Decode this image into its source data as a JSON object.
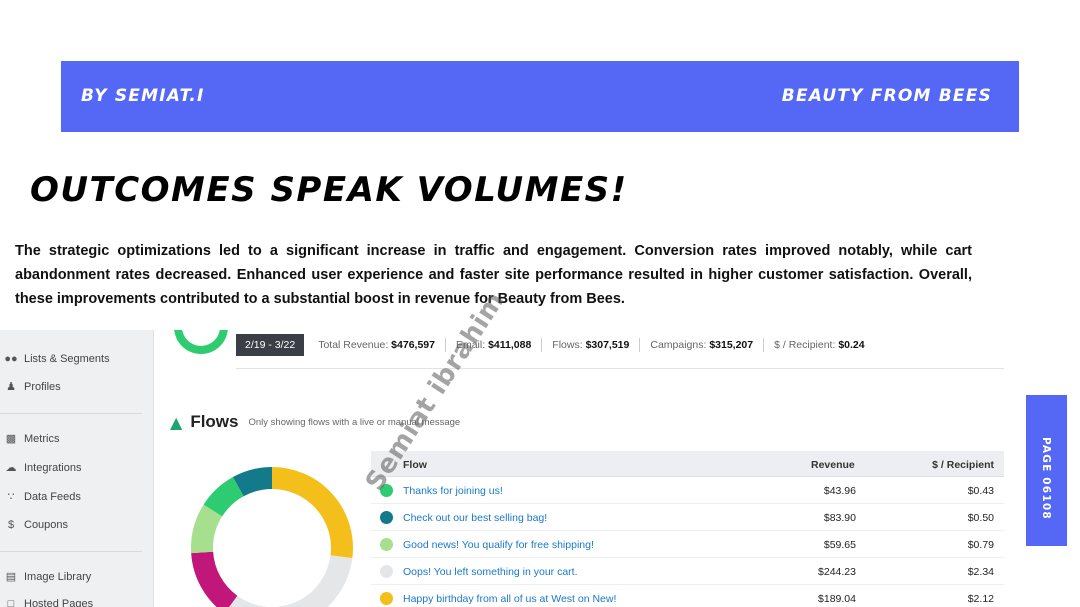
{
  "banner": {
    "left_text": "BY SEMIAT.I",
    "right_text": "BEAUTY FROM BEES",
    "color": "#5468f5"
  },
  "headline": "OUTCOMES SPEAK VOLUMES!",
  "body": "The strategic optimizations led to a significant increase in traffic and engagement. Conversion rates improved notably, while cart abandonment rates decreased. Enhanced user experience and faster site performance resulted in higher customer satisfaction. Overall, these improvements contributed to a substantial boost in revenue for Beauty from Bees.",
  "sidebar": {
    "items": [
      {
        "label": "Lists & Segments",
        "icon": "users-icon"
      },
      {
        "label": "Profiles",
        "icon": "person-icon"
      },
      {
        "label": "Metrics",
        "icon": "bar-chart-icon"
      },
      {
        "label": "Integrations",
        "icon": "cloud-icon"
      },
      {
        "label": "Data Feeds",
        "icon": "rss-icon"
      },
      {
        "label": "Coupons",
        "icon": "dollar-icon"
      },
      {
        "label": "Image Library",
        "icon": "image-icon"
      },
      {
        "label": "Hosted Pages",
        "icon": "page-icon"
      }
    ]
  },
  "stats": {
    "date_range": "2/19 - 3/22",
    "total_revenue_label": "Total Revenue:",
    "total_revenue": "$476,597",
    "email_label": "Email:",
    "email": "$411,088",
    "flows_label": "Flows:",
    "flows": "$307,519",
    "campaigns_label": "Campaigns:",
    "campaigns": "$315,207",
    "per_recipient_label": "$ / Recipient:",
    "per_recipient": "$0.24"
  },
  "flows_section": {
    "title": "Flows",
    "subtitle": "Only showing flows with a live or manual message",
    "headers": {
      "flow": "Flow",
      "revenue": "Revenue",
      "per_recipient": "$ / Recipient"
    },
    "rows": [
      {
        "name": "Thanks for joining us!",
        "revenue": "$43.96",
        "per_recipient": "$0.43",
        "color": "#2ecc71"
      },
      {
        "name": "Check out our best selling bag!",
        "revenue": "$83.90",
        "per_recipient": "$0.50",
        "color": "#137a8c"
      },
      {
        "name": "Good news! You qualify for free shipping!",
        "revenue": "$59.65",
        "per_recipient": "$0.79",
        "color": "#a6e08f"
      },
      {
        "name": "Oops! You left something in your cart.",
        "revenue": "$244.23",
        "per_recipient": "$2.34",
        "color": "#e4e6e8"
      },
      {
        "name": "Happy birthday from all of us at West on New!",
        "revenue": "$189.04",
        "per_recipient": "$2.12",
        "color": "#f4bf1a"
      }
    ],
    "donut_segments": [
      {
        "color": "#f4bf1a",
        "share": 0.27
      },
      {
        "color": "#e4e6e8",
        "share": 0.33
      },
      {
        "color": "#c2177a",
        "share": 0.14
      },
      {
        "color": "#a6e08f",
        "share": 0.1
      },
      {
        "color": "#2ecc71",
        "share": 0.08
      },
      {
        "color": "#137a8c",
        "share": 0.08
      }
    ]
  },
  "watermark": "Semiat ibrahim",
  "page_label": "PAGE 06108"
}
